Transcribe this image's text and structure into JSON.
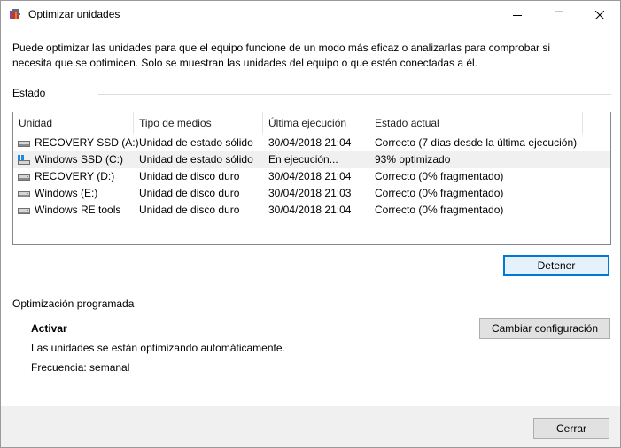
{
  "window": {
    "title": "Optimizar unidades",
    "controls": {
      "minimize": "minimize-icon",
      "maximize": "maximize-icon",
      "close": "close-icon"
    }
  },
  "description": "Puede optimizar las unidades para que el equipo funcione de un modo más eficaz o analizarlas para comprobar si necesita que se optimicen. Solo se muestran las unidades del equipo o que estén conectadas a él.",
  "status_section": {
    "label": "Estado",
    "columns": [
      "Unidad",
      "Tipo de medios",
      "Última ejecución",
      "Estado actual"
    ],
    "drives": [
      {
        "name": "RECOVERY SSD (A:)",
        "media_type": "Unidad de estado sólido",
        "last_run": "30/04/2018 21:04",
        "status": "Correcto (7 días desde la última ejecución)",
        "icon": "hard-drive-icon"
      },
      {
        "name": "Windows SSD (C:)",
        "media_type": "Unidad de estado sólido",
        "last_run": "En ejecución...",
        "status": "93% optimizado",
        "icon": "windows-drive-icon"
      },
      {
        "name": "RECOVERY (D:)",
        "media_type": "Unidad de disco duro",
        "last_run": "30/04/2018 21:04",
        "status": "Correcto (0% fragmentado)",
        "icon": "hard-drive-icon"
      },
      {
        "name": "Windows (E:)",
        "media_type": "Unidad de disco duro",
        "last_run": "30/04/2018 21:03",
        "status": "Correcto (0% fragmentado)",
        "icon": "hard-drive-icon"
      },
      {
        "name": "Windows RE tools",
        "media_type": "Unidad de disco duro",
        "last_run": "30/04/2018 21:04",
        "status": "Correcto (0% fragmentado)",
        "icon": "hard-drive-icon"
      }
    ],
    "stop_button": "Detener"
  },
  "scheduled_section": {
    "label": "Optimización programada",
    "state": "Activar",
    "info": "Las unidades se están optimizando automáticamente.",
    "frequency": "Frecuencia: semanal",
    "change_button": "Cambiar configuración"
  },
  "close_button": "Cerrar",
  "colors": {
    "selection_row": "#f0f0f0",
    "default_button_border": "#0078d7",
    "bottom_bar": "#f0f0f0"
  }
}
